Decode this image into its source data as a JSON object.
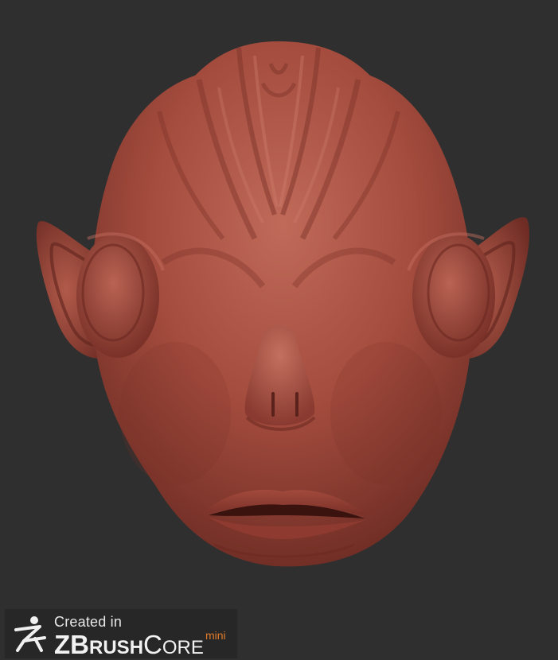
{
  "badge": {
    "created_in": "Created in",
    "brand_z": "Z",
    "brand_brush_b": "B",
    "brand_brush_rest": "RUSH",
    "brand_core_c": "C",
    "brand_core_rest": "ORE",
    "edition": "mini",
    "edition_color": "#e07a2a"
  },
  "scene": {
    "background_color": "#2f2f2f",
    "material_color": "#a8483a",
    "subject": "sculpted-creature-head"
  }
}
